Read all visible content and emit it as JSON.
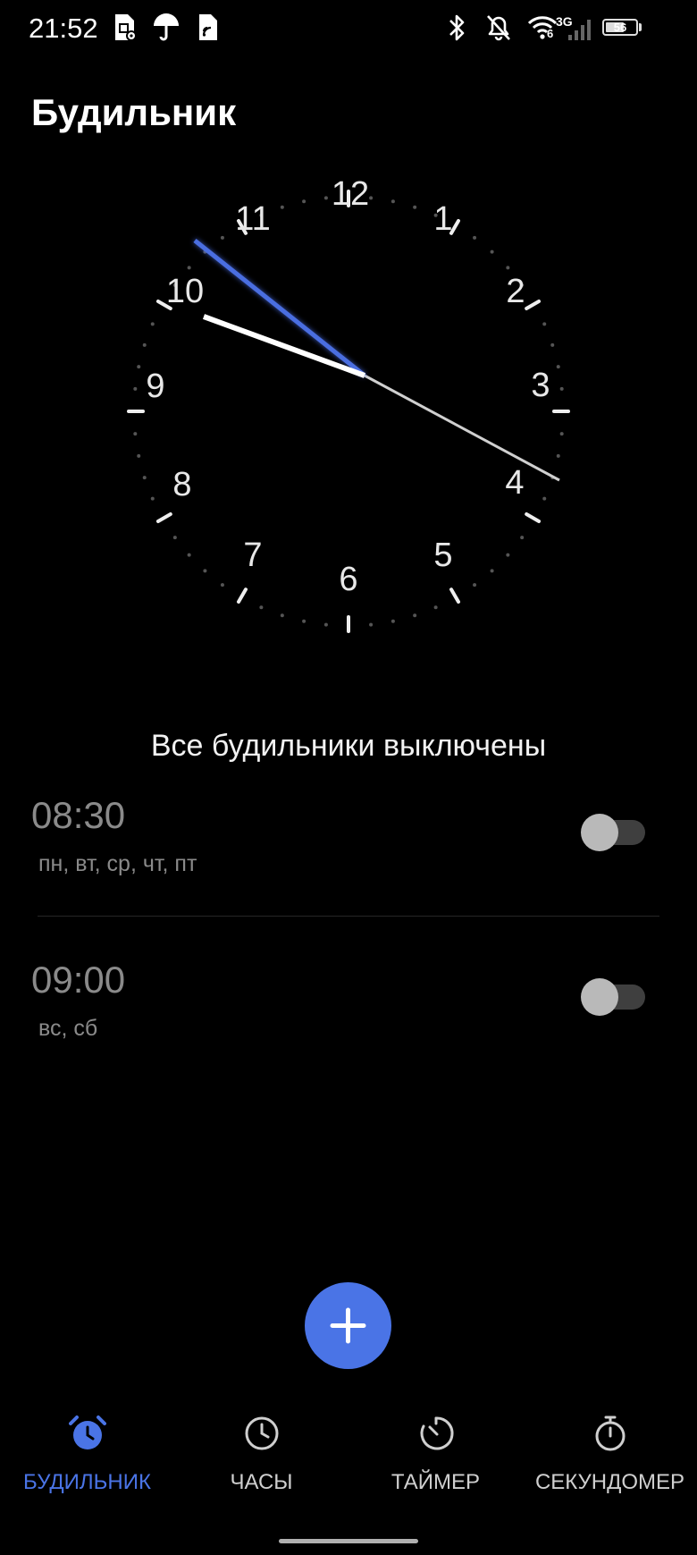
{
  "status_bar": {
    "time": "21:52",
    "left_icons": [
      "sim-settings-icon",
      "umbrella-icon",
      "sim-card-icon"
    ],
    "right_icons": [
      "bluetooth-icon",
      "bell-off-icon",
      "wifi-6-icon",
      "signal-3g-icon",
      "battery-icon"
    ],
    "wifi_label": "6",
    "network_label": "3G",
    "battery_level": "56"
  },
  "header": {
    "title": "Будильник"
  },
  "clock": {
    "numbers": [
      "12",
      "1",
      "2",
      "3",
      "4",
      "5",
      "6",
      "7",
      "8",
      "9",
      "10",
      "11"
    ],
    "hour_hand_color": "#ffffff",
    "minute_hand_color": "#4a6ee0",
    "second_hand_color": "#d0d0d0"
  },
  "alarms_status": "Все будильники выключены",
  "alarms": [
    {
      "time": "08:30",
      "days": "пн, вт, ср, чт, пт",
      "enabled": false
    },
    {
      "time": "09:00",
      "days": "вс, сб",
      "enabled": false
    }
  ],
  "fab": {
    "icon": "plus-icon",
    "color": "#4a74e6"
  },
  "nav": {
    "tabs": [
      {
        "label": "БУДИЛЬНИК",
        "icon": "alarm-clock-icon",
        "active": true
      },
      {
        "label": "ЧАСЫ",
        "icon": "clock-icon",
        "active": false
      },
      {
        "label": "ТАЙМЕР",
        "icon": "timer-icon",
        "active": false
      },
      {
        "label": "СЕКУНДОМЕР",
        "icon": "stopwatch-icon",
        "active": false
      }
    ],
    "active_color": "#4a74e6"
  }
}
